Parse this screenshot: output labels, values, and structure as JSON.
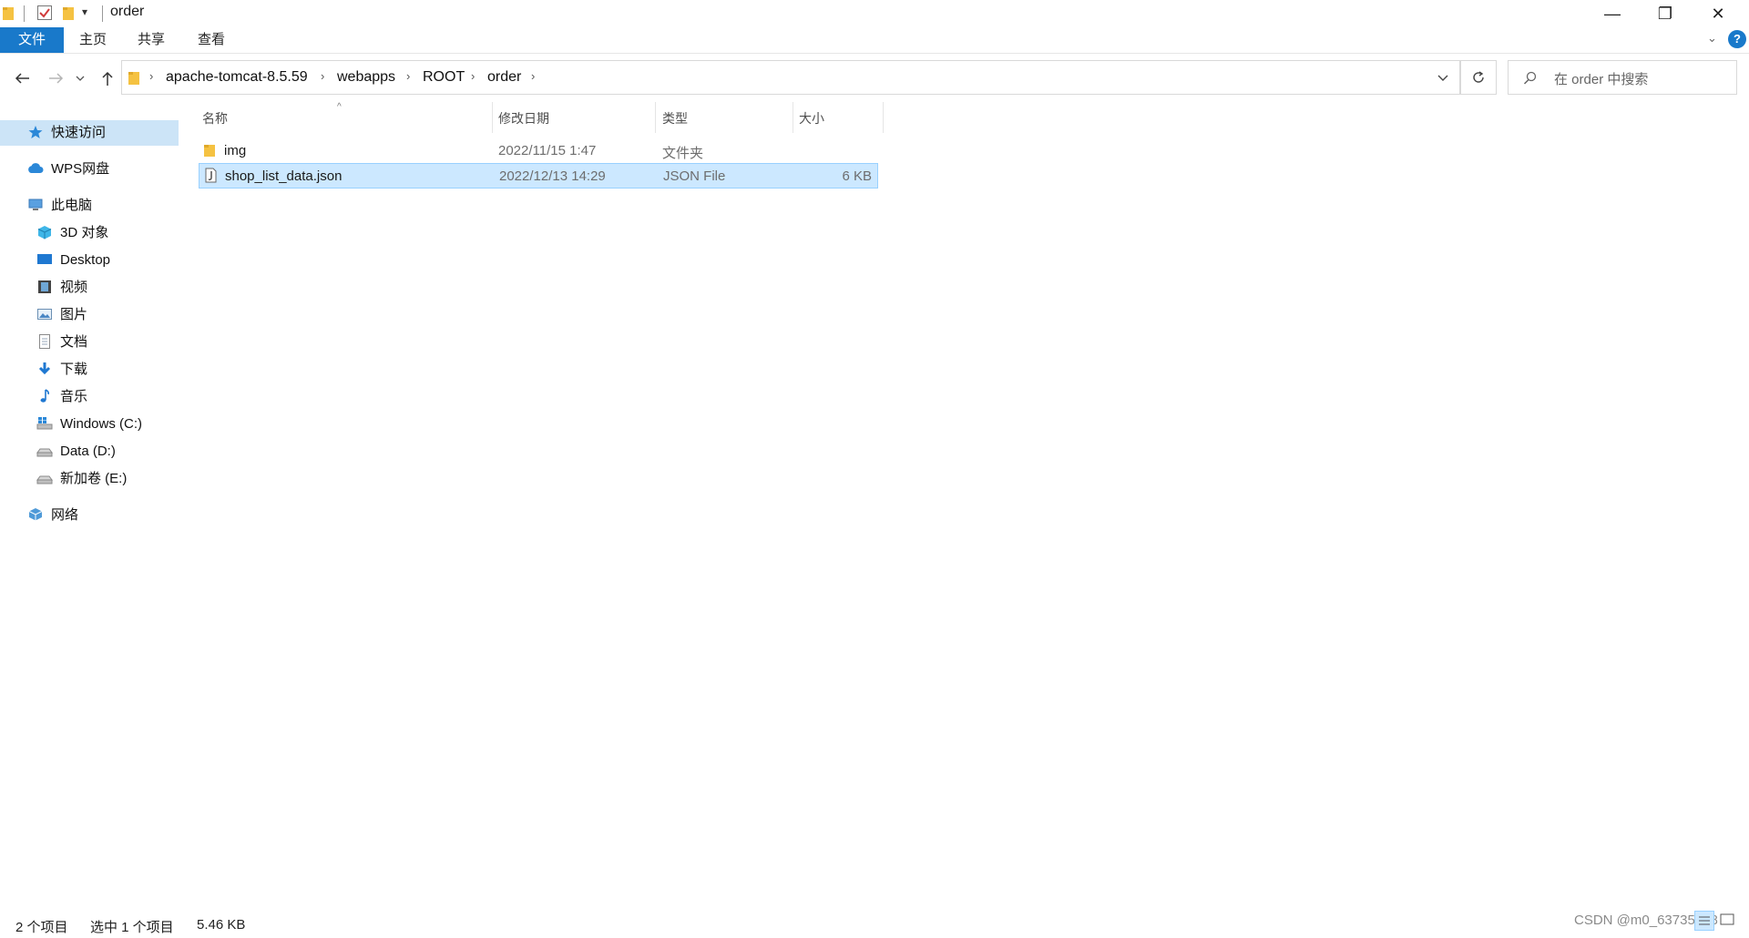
{
  "window": {
    "title": "order",
    "controls": {
      "minimize": "—",
      "restore": "❐",
      "close": "✕"
    }
  },
  "ribbon": {
    "tabs": [
      "文件",
      "主页",
      "共享",
      "查看"
    ],
    "help_label": "?"
  },
  "address": {
    "crumbs": [
      "apache-tomcat-8.5.59",
      "webapps",
      "ROOT",
      "order"
    ]
  },
  "search": {
    "placeholder": "在 order 中搜索"
  },
  "sidebar": {
    "items": [
      {
        "label": "快速访问",
        "icon": "star-icon"
      },
      {
        "label": "WPS网盘",
        "icon": "cloud-icon"
      },
      {
        "label": "此电脑",
        "icon": "computer-icon"
      },
      {
        "label": "3D 对象",
        "icon": "cube-icon"
      },
      {
        "label": "Desktop",
        "icon": "desktop-icon"
      },
      {
        "label": "视频",
        "icon": "video-icon"
      },
      {
        "label": "图片",
        "icon": "picture-icon"
      },
      {
        "label": "文档",
        "icon": "document-icon"
      },
      {
        "label": "下载",
        "icon": "download-icon"
      },
      {
        "label": "音乐",
        "icon": "music-icon"
      },
      {
        "label": "Windows (C:)",
        "icon": "drive-c-icon"
      },
      {
        "label": "Data (D:)",
        "icon": "drive-icon"
      },
      {
        "label": "新加卷 (E:)",
        "icon": "drive-icon"
      },
      {
        "label": "网络",
        "icon": "network-icon"
      }
    ]
  },
  "list": {
    "columns": [
      "名称",
      "修改日期",
      "类型",
      "大小"
    ],
    "rows": [
      {
        "name": "img",
        "date": "2022/11/15 1:47",
        "type": "文件夹",
        "size": "",
        "icon": "folder-icon"
      },
      {
        "name": "shop_list_data.json",
        "date": "2022/12/13 14:29",
        "type": "JSON File",
        "size": "6 KB",
        "icon": "json-file-icon"
      }
    ]
  },
  "status": {
    "count": "2 个项目",
    "selected": "选中 1 个项目",
    "size": "5.46 KB"
  },
  "watermark": "CSDN @m0_63735628",
  "colors": {
    "accent": "#1979ca",
    "selection": "#cce8ff",
    "selection_border": "#99d1ff",
    "sidebar_selection": "#cce4f7",
    "folder": "#f5c242"
  }
}
